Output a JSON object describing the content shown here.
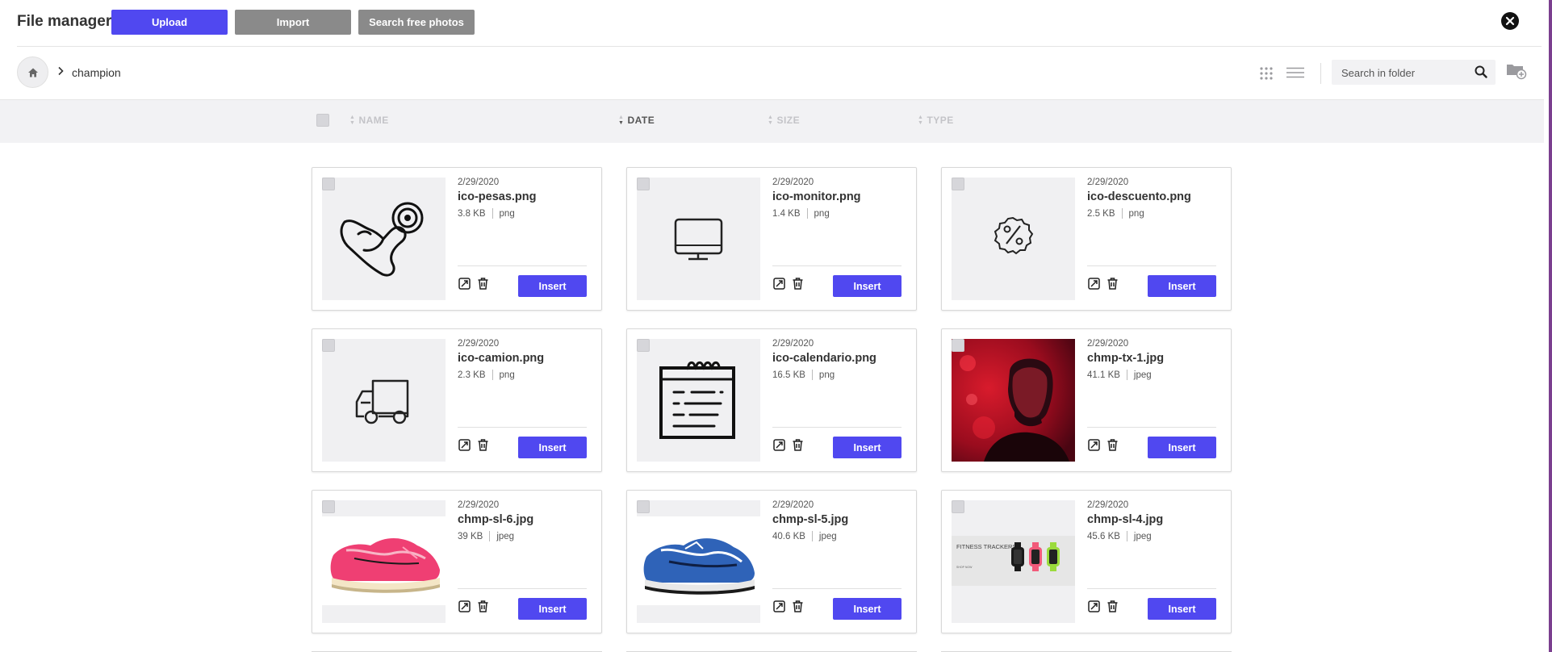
{
  "header": {
    "title": "File manager",
    "upload_label": "Upload",
    "import_label": "Import",
    "search_photos_label": "Search free photos"
  },
  "path": {
    "separator": ">",
    "current_folder": "champion"
  },
  "search": {
    "placeholder": "Search in folder"
  },
  "columns": {
    "name": "NAME",
    "date": "DATE",
    "size": "SIZE",
    "type": "TYPE"
  },
  "files": [
    {
      "date": "2/29/2020",
      "name": "ico-pesas.png",
      "size": "3.8 KB",
      "type": "png",
      "insert": "Insert",
      "thumb": "muscle-icon"
    },
    {
      "date": "2/29/2020",
      "name": "ico-monitor.png",
      "size": "1.4 KB",
      "type": "png",
      "insert": "Insert",
      "thumb": "monitor-icon"
    },
    {
      "date": "2/29/2020",
      "name": "ico-descuento.png",
      "size": "2.5 KB",
      "type": "png",
      "insert": "Insert",
      "thumb": "discount-icon"
    },
    {
      "date": "2/29/2020",
      "name": "ico-camion.png",
      "size": "2.3 KB",
      "type": "png",
      "insert": "Insert",
      "thumb": "truck-icon"
    },
    {
      "date": "2/29/2020",
      "name": "ico-calendario.png",
      "size": "16.5 KB",
      "type": "png",
      "insert": "Insert",
      "thumb": "calendar-icon"
    },
    {
      "date": "2/29/2020",
      "name": "chmp-tx-1.jpg",
      "size": "41.1 KB",
      "type": "jpeg",
      "insert": "Insert",
      "thumb": "portrait-photo"
    },
    {
      "date": "2/29/2020",
      "name": "chmp-sl-6.jpg",
      "size": "39 KB",
      "type": "jpeg",
      "insert": "Insert",
      "thumb": "pink-shoe-photo"
    },
    {
      "date": "2/29/2020",
      "name": "chmp-sl-5.jpg",
      "size": "40.6 KB",
      "type": "jpeg",
      "insert": "Insert",
      "thumb": "blue-shoe-photo"
    },
    {
      "date": "2/29/2020",
      "name": "chmp-sl-4.jpg",
      "size": "45.6 KB",
      "type": "jpeg",
      "insert": "Insert",
      "thumb": "fitness-trackers-banner",
      "banner_text": "FITNESS TRACKERS",
      "banner_button": "SHOP NOW"
    }
  ],
  "colors": {
    "accent": "#5048f0",
    "secondary_button": "#8a8a8a",
    "header_row_bg": "#f2f2f4"
  }
}
